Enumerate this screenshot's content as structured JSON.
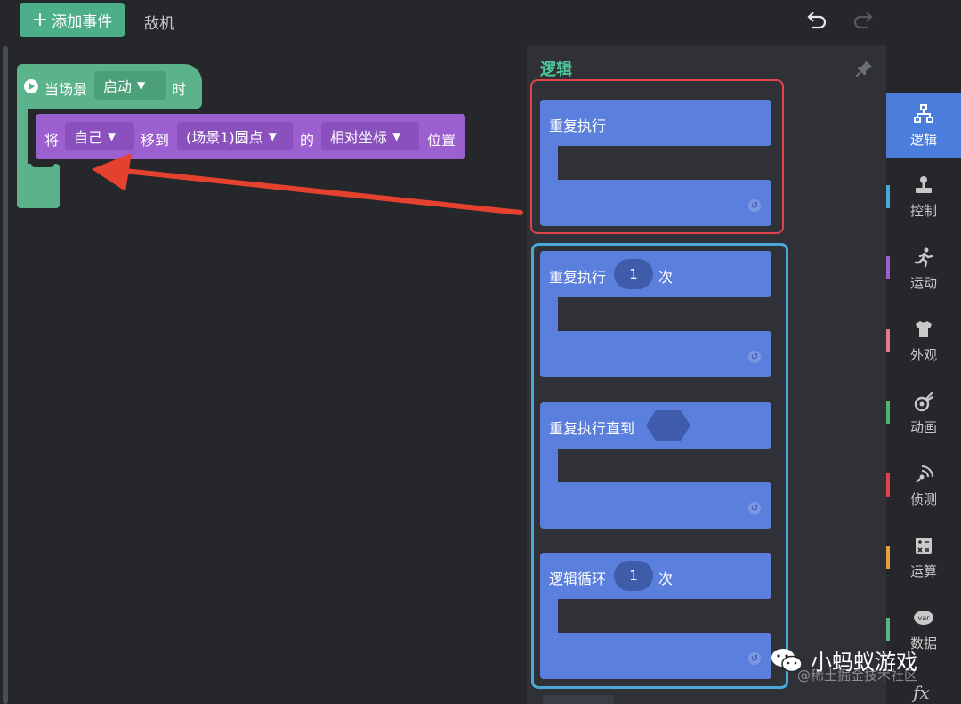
{
  "toolbar": {
    "add_event_label": "添加事件",
    "tab_enemy": "敌机"
  },
  "event_block": {
    "prefix": "当场景",
    "dropdown": "启动",
    "suffix": "时"
  },
  "move_block": {
    "word_1": "将",
    "dropdown_1": "自己",
    "word_2": "移到",
    "dropdown_2": "(场景1)圆点",
    "word_3": "的",
    "dropdown_3": "相对坐标",
    "word_4": "位置"
  },
  "panel": {
    "title": "逻辑",
    "blocks": [
      {
        "label": "重复执行"
      },
      {
        "label": "重复执行",
        "count": "1",
        "unit": "次"
      },
      {
        "label": "重复执行直到"
      },
      {
        "label": "逻辑循环",
        "count": "1",
        "unit": "次"
      }
    ]
  },
  "categories": [
    {
      "label": "逻辑",
      "icon": "logic-tree-icon",
      "active": true
    },
    {
      "label": "控制",
      "icon": "joystick-icon",
      "color": "#4aa8d8"
    },
    {
      "label": "运动",
      "icon": "running-man-icon",
      "color": "#9c5fd0"
    },
    {
      "label": "外观",
      "icon": "shirt-icon",
      "color": "#e07b8a"
    },
    {
      "label": "动画",
      "icon": "animation-icon",
      "color": "#4fb36a"
    },
    {
      "label": "侦测",
      "icon": "radar-icon",
      "color": "#e0444a"
    },
    {
      "label": "运算",
      "icon": "calculator-icon",
      "color": "#e0a23a"
    },
    {
      "label": "数据",
      "icon": "var-icon",
      "color": "#5ab38a"
    }
  ],
  "fx_label": "fx",
  "watermark": {
    "main": "小蚂蚁游戏",
    "sub": "@稀土掘金技术社区"
  },
  "colors": {
    "event_green": "#5ab38a",
    "motion_purple": "#9c5fd0",
    "logic_blue": "#5b7fdc",
    "highlight_red": "#e0444a",
    "highlight_blue": "#4aa8d8"
  }
}
